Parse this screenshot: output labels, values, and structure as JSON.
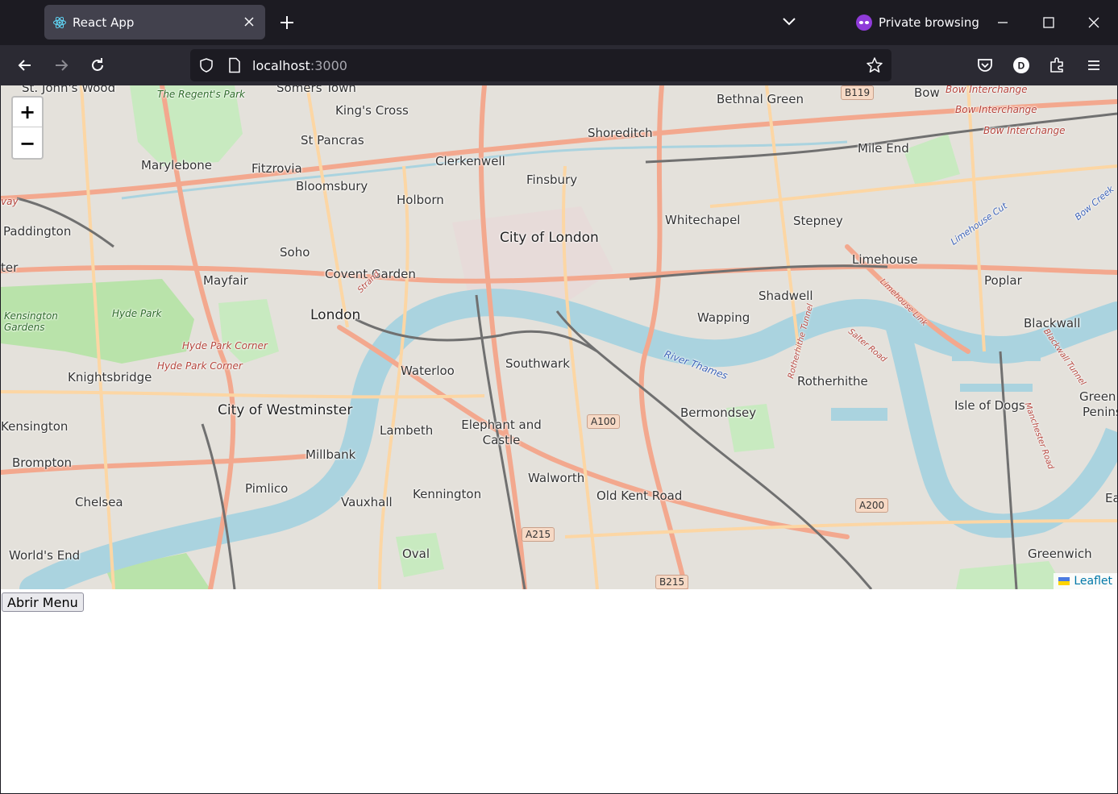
{
  "browser": {
    "tab": {
      "title": "React App",
      "favicon": "react-icon"
    },
    "private_label": "Private browsing",
    "url_host": "localhost",
    "url_port": ":3000",
    "account_initial": "D"
  },
  "map": {
    "zoom_in_label": "+",
    "zoom_out_label": "−",
    "attribution_link": "Leaflet",
    "places": [
      {
        "id": "regents-park",
        "text": "The Regent's Park"
      },
      {
        "id": "kings-cross",
        "text": "King's Cross"
      },
      {
        "id": "st-pancras",
        "text": "St Pancras"
      },
      {
        "id": "somers-town",
        "text": "Somers Town"
      },
      {
        "id": "st-johns-wood",
        "text": "St. John's Wood"
      },
      {
        "id": "marylebone",
        "text": "Marylebone"
      },
      {
        "id": "fitzrovia",
        "text": "Fitzrovia"
      },
      {
        "id": "bloomsbury",
        "text": "Bloomsbury"
      },
      {
        "id": "clerkenwell",
        "text": "Clerkenwell"
      },
      {
        "id": "finsbury",
        "text": "Finsbury"
      },
      {
        "id": "shoreditch",
        "text": "Shoreditch"
      },
      {
        "id": "bethnal-green",
        "text": "Bethnal Green"
      },
      {
        "id": "bow",
        "text": "Bow"
      },
      {
        "id": "mile-end",
        "text": "Mile End"
      },
      {
        "id": "holborn",
        "text": "Holborn"
      },
      {
        "id": "paddington",
        "text": "Paddington"
      },
      {
        "id": "soho",
        "text": "Soho"
      },
      {
        "id": "whitechapel",
        "text": "Whitechapel"
      },
      {
        "id": "stepney",
        "text": "Stepney"
      },
      {
        "id": "city-of-london",
        "text": "City of London"
      },
      {
        "id": "limehouse",
        "text": "Limehouse"
      },
      {
        "id": "mayfair",
        "text": "Mayfair"
      },
      {
        "id": "covent-garden",
        "text": "Covent Garden"
      },
      {
        "id": "poplar",
        "text": "Poplar"
      },
      {
        "id": "shadwell",
        "text": "Shadwell"
      },
      {
        "id": "london",
        "text": "London"
      },
      {
        "id": "wapping",
        "text": "Wapping"
      },
      {
        "id": "kensington-gardens",
        "text": "Kensington Gardens"
      },
      {
        "id": "hyde-park",
        "text": "Hyde Park"
      },
      {
        "id": "blackwall",
        "text": "Blackwall"
      },
      {
        "id": "hyde-park-corner-1",
        "text": "Hyde Park Corner"
      },
      {
        "id": "hyde-park-corner-2",
        "text": "Hyde Park Corner"
      },
      {
        "id": "southwark",
        "text": "Southwark"
      },
      {
        "id": "waterloo",
        "text": "Waterloo"
      },
      {
        "id": "knightsbridge",
        "text": "Knightsbridge"
      },
      {
        "id": "rotherhithe",
        "text": "Rotherhithe"
      },
      {
        "id": "isle-of-dogs",
        "text": "Isle of Dogs"
      },
      {
        "id": "city-of-westminster",
        "text": "City of Westminster"
      },
      {
        "id": "bermondsey",
        "text": "Bermondsey"
      },
      {
        "id": "kensington",
        "text": "Kensington"
      },
      {
        "id": "lambeth",
        "text": "Lambeth"
      },
      {
        "id": "elephant-and-castle",
        "text": "Elephant and Castle"
      },
      {
        "id": "millbank",
        "text": "Millbank"
      },
      {
        "id": "brompton",
        "text": "Brompton"
      },
      {
        "id": "walworth",
        "text": "Walworth"
      },
      {
        "id": "pimlico",
        "text": "Pimlico"
      },
      {
        "id": "kennington",
        "text": "Kennington"
      },
      {
        "id": "old-kent-road",
        "text": "Old Kent Road"
      },
      {
        "id": "chelsea",
        "text": "Chelsea"
      },
      {
        "id": "vauxhall",
        "text": "Vauxhall"
      },
      {
        "id": "oval",
        "text": "Oval"
      },
      {
        "id": "worlds-end",
        "text": "World's End"
      },
      {
        "id": "greenwich",
        "text": "Greenwich"
      },
      {
        "id": "bow-interchange-1",
        "text": "Bow Interchange"
      },
      {
        "id": "bow-interchange-2",
        "text": "Bow Interchange"
      },
      {
        "id": "bow-interchange-3",
        "text": "Bow Interchange"
      },
      {
        "id": "river-thames",
        "text": "River Thames"
      },
      {
        "id": "strand",
        "text": "Strand"
      },
      {
        "id": "limehouse-link",
        "text": "Limehouse Link"
      },
      {
        "id": "rotherhithe-tunnel",
        "text": "Rotherhithe Tunnel"
      },
      {
        "id": "salter-road",
        "text": "Salter Road"
      },
      {
        "id": "blackwall-tunnel",
        "text": "Blackwall Tunnel"
      },
      {
        "id": "manchester-road",
        "text": "Manchester Road"
      },
      {
        "id": "limehouse-cut",
        "text": "Limehouse Cut"
      },
      {
        "id": "bow-creek",
        "text": "Bow Creek"
      },
      {
        "id": "green-edge",
        "text": "Green"
      },
      {
        "id": "penins-edge",
        "text": "Penins"
      },
      {
        "id": "ea-edge",
        "text": "Ea"
      },
      {
        "id": "ter-edge",
        "text": "ter"
      },
      {
        "id": "vay-edge",
        "text": "vay"
      }
    ],
    "shields": [
      {
        "id": "b119",
        "text": "B119"
      },
      {
        "id": "a100",
        "text": "A100"
      },
      {
        "id": "a200",
        "text": "A200"
      },
      {
        "id": "a215",
        "text": "A215"
      },
      {
        "id": "b215",
        "text": "B215"
      }
    ]
  },
  "page": {
    "menu_button_label": "Abrir Menu"
  }
}
